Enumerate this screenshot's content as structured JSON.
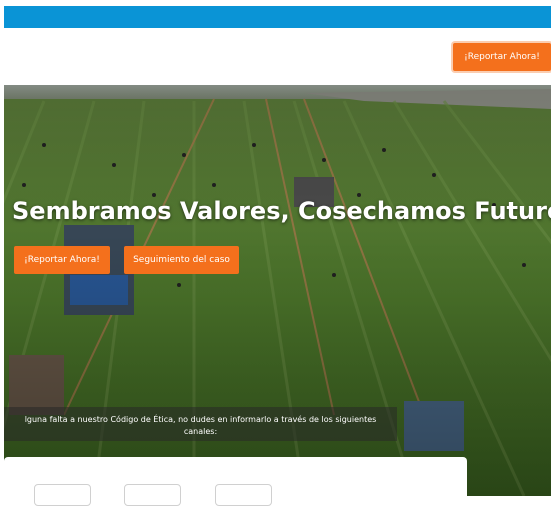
{
  "header": {
    "report_button": "¡Reportar Ahora!"
  },
  "hero": {
    "title": "Sembramos Valores, Cosechamos Futuro",
    "report_button": "¡Reportar Ahora!",
    "follow_button": "Seguimiento del caso",
    "info_line1": "lguna falta a nuestro Código de Ética, no dudes en informarlo a través de los siguientes",
    "info_line2": "canales:"
  },
  "colors": {
    "topbar": "#0a94d6",
    "accent": "#f4701c"
  },
  "icons": {
    "tiles": [
      "channel-tile",
      "channel-tile",
      "channel-tile"
    ]
  }
}
